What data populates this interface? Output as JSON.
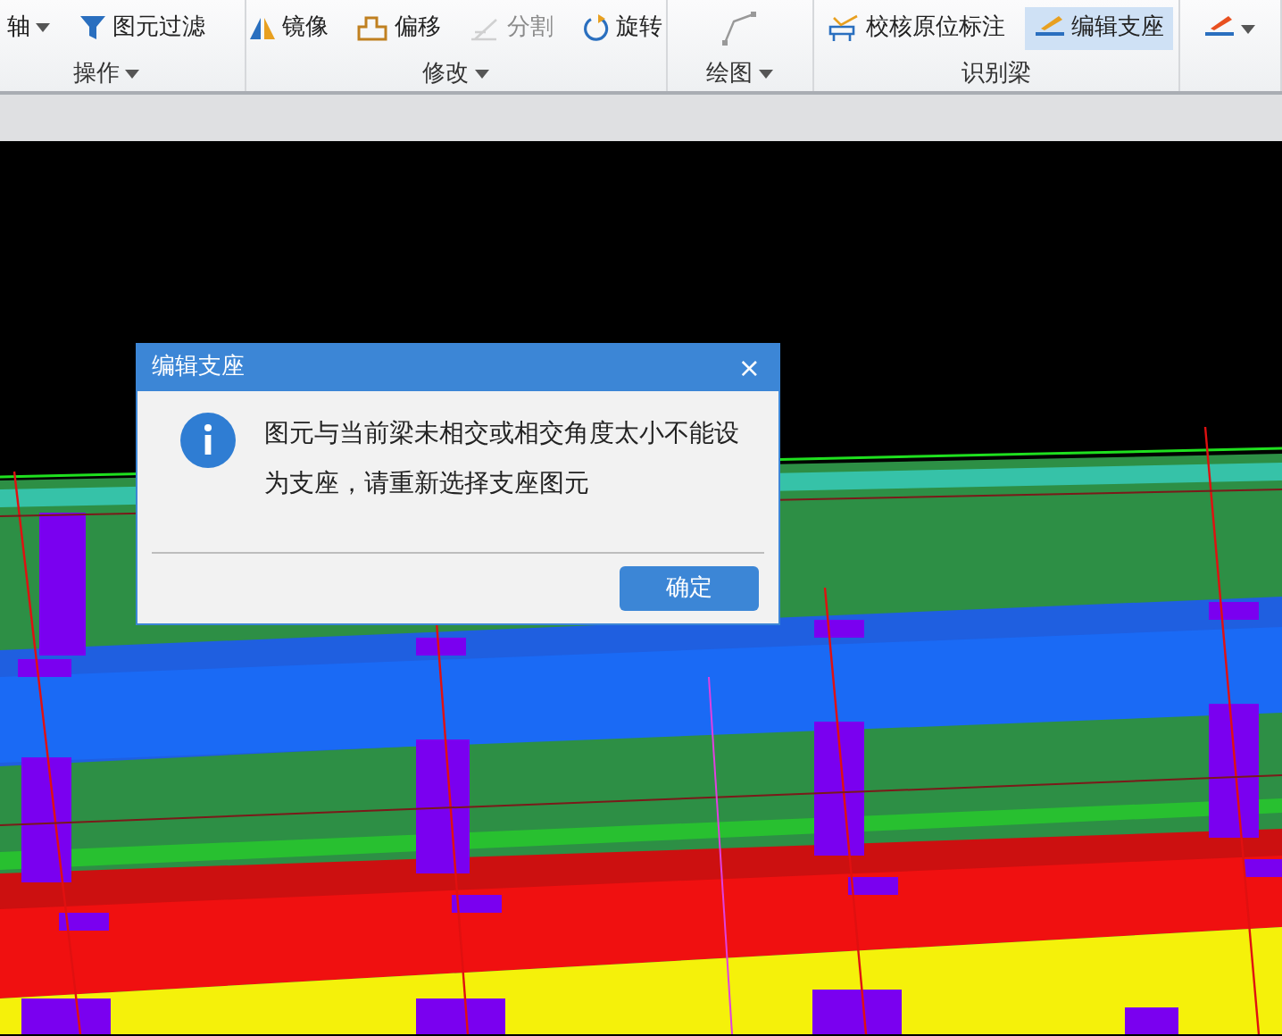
{
  "ribbon": {
    "groups": [
      {
        "label": "操作",
        "items": [
          {
            "label": "轴",
            "kind": "dropdown",
            "disabled": false,
            "selected": false
          },
          {
            "label": "图元过滤",
            "kind": "button",
            "disabled": false,
            "selected": false
          }
        ]
      },
      {
        "label": "修改",
        "items": [
          {
            "label": "镜像",
            "kind": "button",
            "disabled": false,
            "selected": false
          },
          {
            "label": "偏移",
            "kind": "button",
            "disabled": false,
            "selected": false
          },
          {
            "label": "分割",
            "kind": "button",
            "disabled": true,
            "selected": false
          },
          {
            "label": "旋转",
            "kind": "button",
            "disabled": false,
            "selected": false
          }
        ]
      },
      {
        "label": "绘图",
        "items": [
          {
            "kind": "icon",
            "disabled": false,
            "selected": false
          }
        ]
      },
      {
        "label": "识别梁",
        "items": [
          {
            "label": "校核原位标注",
            "kind": "button",
            "disabled": false,
            "selected": false
          },
          {
            "label": "编辑支座",
            "kind": "button",
            "disabled": false,
            "selected": true
          }
        ]
      },
      {
        "items": [
          {
            "kind": "icon-dropdown",
            "disabled": false,
            "selected": false
          }
        ]
      }
    ]
  },
  "dialog": {
    "title": "编辑支座",
    "close": "×",
    "message": "图元与当前梁未相交或相交角度太小不能设为支座，请重新选择支座图元",
    "buttons": [
      "确定"
    ]
  }
}
